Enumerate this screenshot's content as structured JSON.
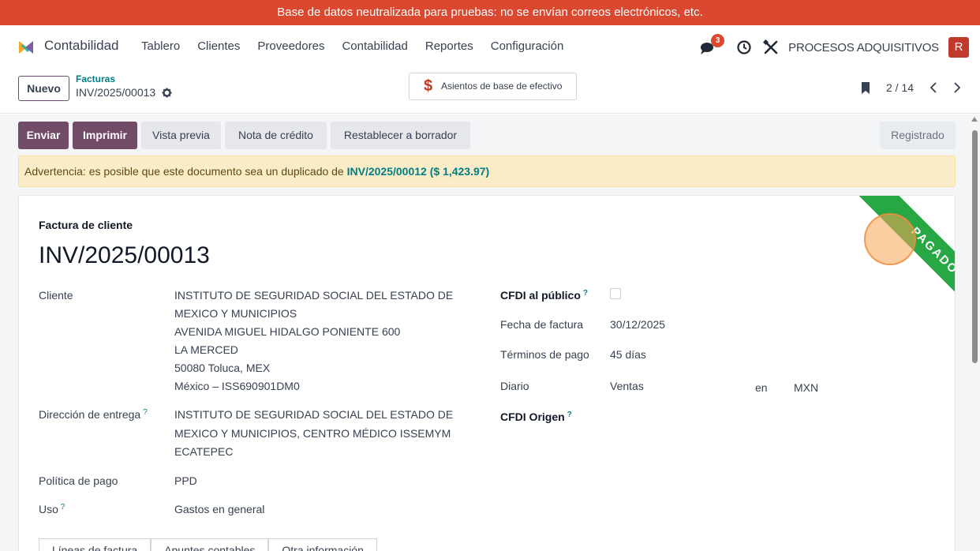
{
  "banner": {
    "text": "Base de datos neutralizada para pruebas: no se envían correos electrónicos, etc."
  },
  "navbar": {
    "app_name": "Contabilidad",
    "menu": [
      "Tablero",
      "Clientes",
      "Proveedores",
      "Contabilidad",
      "Reportes",
      "Configuración"
    ],
    "chat_count": "3",
    "company": "PROCESOS ADQUISITIVOS",
    "avatar_letter": "R"
  },
  "control_panel": {
    "new_label": "Nuevo",
    "breadcrumb_parent": "Facturas",
    "breadcrumb_current": "INV/2025/00013",
    "cash_basis_label": "Asientos de base de efectivo",
    "pager": "2 / 14"
  },
  "actions": {
    "send": "Enviar",
    "print": "Imprimir",
    "preview": "Vista previa",
    "credit_note": "Nota de crédito",
    "reset_draft": "Restablecer a borrador",
    "status": "Registrado"
  },
  "warning": {
    "text": "Advertencia: es posible que este documento sea un duplicado de",
    "link": "INV/2025/00012 ($ 1,423.97)"
  },
  "invoice": {
    "type_label": "Factura de cliente",
    "name": "INV/2025/00013",
    "ribbon": "PAGADO",
    "customer_label": "Cliente",
    "customer_name_1": "INSTITUTO DE SEGURIDAD SOCIAL DEL ESTADO DE",
    "customer_name_2": "MEXICO Y MUNICIPIOS",
    "address_1": "AVENIDA MIGUEL HIDALGO PONIENTE 600",
    "address_2": "LA MERCED",
    "address_3": "50080 Toluca, MEX",
    "address_4": "México – ISS690901DM0",
    "delivery_label": "Dirección de entrega",
    "delivery_1": "INSTITUTO DE SEGURIDAD SOCIAL DEL ESTADO DE",
    "delivery_2": "MEXICO Y MUNICIPIOS, CENTRO MÉDICO ISSEMYM",
    "delivery_3": "ECATEPEC",
    "payment_policy_label": "Política de pago",
    "payment_policy": "PPD",
    "usage_label": "Uso",
    "usage": "Gastos en general",
    "cfdi_public_label": "CFDI al público",
    "cfdi_public_checked": false,
    "invoice_date_label": "Fecha de factura",
    "invoice_date": "30/12/2025",
    "payment_terms_label": "Términos de pago",
    "payment_terms": "45 días",
    "journal_label": "Diario",
    "journal": "Ventas",
    "currency_prefix": "en",
    "currency": "MXN",
    "cfdi_origin_label": "CFDI Origen",
    "help_mark": "?"
  },
  "tabs": [
    "Líneas de factura",
    "Apuntes contables",
    "Otra información"
  ],
  "colors": {
    "banner": "#d9482f",
    "primary": "#714b67",
    "link": "#017e84",
    "ribbon": "#28a745",
    "warning_bg": "#fbecc8"
  }
}
